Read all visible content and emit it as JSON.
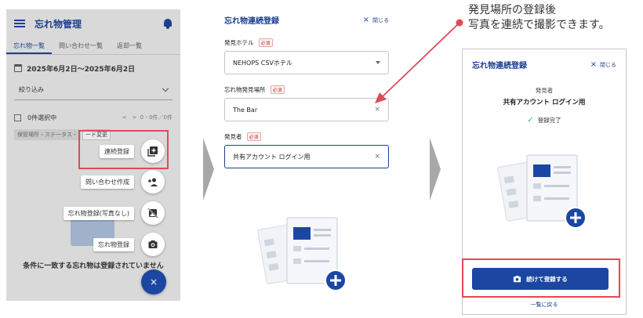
{
  "colors": {
    "primary": "#1b47a3",
    "highlight": "#e04a55",
    "overlay": "#d9d9d9",
    "success": "#4caf50"
  },
  "panel1": {
    "app_title": "忘れ物管理",
    "tabs": [
      "忘れ物一覧",
      "問い合わせ一覧",
      "返却一覧"
    ],
    "date_range": "2025年6月2日〜2025年6月2日",
    "filter_label": "絞り込み",
    "selected_count": "0件選択中",
    "pager": "0 - 0件／0件",
    "chip_text": "保管場所・ステータス・",
    "chip_tag": "ード変更",
    "fab_actions": [
      {
        "label": "連続登録",
        "icon": "add-box-icon"
      },
      {
        "label": "問い合わせ作成",
        "icon": "person-add-icon"
      },
      {
        "label": "忘れ物登録(写真なし)",
        "icon": "no-photo-icon"
      },
      {
        "label": "忘れ物登録",
        "icon": "camera-icon"
      }
    ],
    "fab_close": "×",
    "empty_message": "条件に一致する忘れ物は登録されていません"
  },
  "panel2": {
    "title": "忘れ物連続登録",
    "close_label": "閉じる",
    "required_badge": "必須",
    "fields": [
      {
        "label": "発見ホテル",
        "value": "NEHOPS CSVホテル",
        "control": "dropdown"
      },
      {
        "label": "忘れ物発見場所",
        "value": "The Bar",
        "control": "clear"
      },
      {
        "label": "発見者",
        "value": "共有アカウント ログイン用",
        "control": "clear"
      }
    ]
  },
  "panel3": {
    "title": "忘れ物連続登録",
    "close_label": "閉じる",
    "finder_label": "発見者",
    "finder_name": "共有アカウント ログイン用",
    "done_text": "登録完了",
    "continue_button": "続けて登録する",
    "back_link": "一覧に戻る"
  },
  "callout": {
    "line1": "発見場所の登録後",
    "line2": "写真を連続で撮影できます。"
  }
}
